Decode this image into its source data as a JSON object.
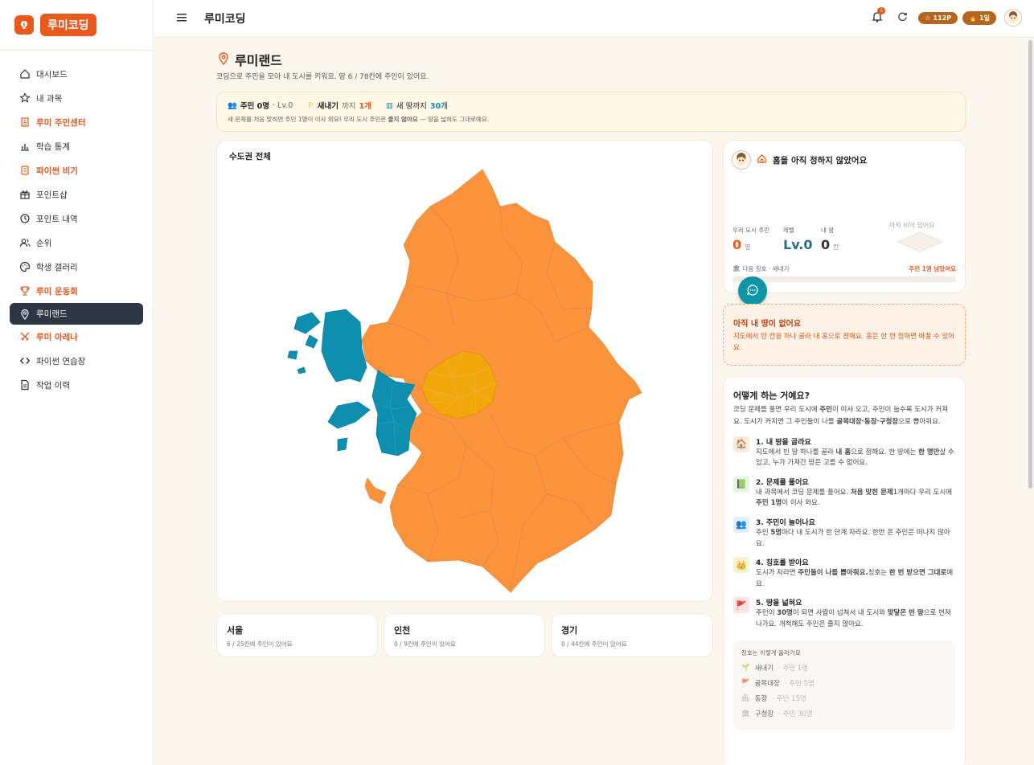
{
  "app": {
    "logo_text": "루미코딩",
    "top_title": "루미코딩",
    "notif_count": "5",
    "points": "112P",
    "streak": "1일"
  },
  "sidebar": {
    "items": [
      {
        "label": "대시보드",
        "icon": "home-icon"
      },
      {
        "label": "내 과목",
        "icon": "star-icon"
      },
      {
        "label": "루미 주민센터",
        "icon": "building-icon"
      },
      {
        "label": "학습 통계",
        "icon": "chart-icon"
      },
      {
        "label": "파이썬 비기",
        "icon": "scroll-icon"
      },
      {
        "label": "포인트샵",
        "icon": "gift-icon"
      },
      {
        "label": "포인트 내역",
        "icon": "history-icon"
      },
      {
        "label": "순위",
        "icon": "users-icon"
      },
      {
        "label": "학생 갤러리",
        "icon": "palette-icon"
      },
      {
        "label": "루미 운동회",
        "icon": "trophy-icon"
      },
      {
        "label": "루미랜드",
        "icon": "map-pin-icon"
      },
      {
        "label": "루미 아레나",
        "icon": "swords-icon"
      },
      {
        "label": "파이썬 연습장",
        "icon": "code-icon"
      },
      {
        "label": "작업 이력",
        "icon": "file-icon"
      }
    ]
  },
  "page": {
    "title": "루미랜드",
    "description": "코딩으로 주민을 모아 내 도시를 키워요. 땅 6 / 78칸에 주인이 있어요.",
    "info": {
      "residents": "주민 0명",
      "level": "· Lv.0",
      "next_title": "새내기",
      "until": "까지",
      "until_count": "1개",
      "new_land": "새 땅까지",
      "new_land_count": "30개",
      "sub_before": "새 문제를 처음 맞히면 주민 1명이 이사 와요! 우리 도시 주민은",
      "sub_bold": "줄지 않아요",
      "sub_after": "— 땅을 넓혀도 그대로예요."
    }
  },
  "map": {
    "title": "수도권 전체"
  },
  "regions": [
    {
      "name": "서울",
      "status": "6 / 25칸에 주인이 있어요"
    },
    {
      "name": "인천",
      "status": "0 / 9칸에 주인이 있어요"
    },
    {
      "name": "경기",
      "status": "0 / 44칸에 주인이 있어요"
    }
  ],
  "home": {
    "title": "홈을 아직 정하지 않았어요",
    "stat1_label": "우리 도시 주민",
    "stat1_value": "0",
    "stat1_unit": "명",
    "stat2_label": "레벨",
    "stat2_value": "Lv.0",
    "stat3_label": "내 땅",
    "stat3_value": "0",
    "stat3_unit": "칸",
    "empty_note": "아직 비어 있어요",
    "next_title_label": "다음 칭호 · 새내기",
    "remaining": "주민 1명 남았어요"
  },
  "empty_notice": {
    "title": "아직 내 땅이 없어요",
    "text": "지도에서 빈 칸을 하나 골라 내 홈으로 정해요. 홈은 한 번 정하면 바꿀 수 있어요."
  },
  "how": {
    "title": "어떻게 하는 거예요?",
    "intro_1": "코딩 문제를 풀면 우리 도시에",
    "intro_b1": "주민",
    "intro_2": "이 이사 오고, 주민이 늘수록 도시가 커져요. 도시가 커지면 그 주민들이 나를",
    "intro_b2": "골목대장·동장·구청장",
    "intro_3": "으로 뽑아줘요.",
    "steps": [
      {
        "title": "1. 내 땅을 골라요",
        "t1": "지도에서 빈 땅 하나를 골라",
        "b1": "내 홈",
        "t2": "으로 정해요. 한 땅에는",
        "b2": "한 명만",
        "t3": "살 수 있고, 누가 가져간 땅은 고를 수 없어요."
      },
      {
        "title": "2. 문제를 풀어요",
        "t1": "내 과목에서 코딩 문제를 풀어요.",
        "b1": "처음 맞힌 문제",
        "t2": "1개마다 우리 도시에",
        "b2": "주민 1명",
        "t3": "이 이사 와요."
      },
      {
        "title": "3. 주민이 늘어나요",
        "t1": "주민",
        "b1": "5명",
        "t2": "마다 내 도시가 한 단계 자라요. 한번 온 주민은 떠나지 않아요.",
        "b2": "",
        "t3": ""
      },
      {
        "title": "4. 칭호를 받아요",
        "t1": "도시가 자라면",
        "b1": "주민들이 나를 뽑아줘요.",
        "t2": "칭호는",
        "b2": "한 번 받으면 그대로",
        "t3": "예요."
      },
      {
        "title": "5. 땅을 넓혀요",
        "t1": "주민이",
        "b1": "30명",
        "t2": "이 되면 사람이 넘쳐서 내 도시와",
        "b2": "맞닿은 빈 땅",
        "t3": "으로 번져나가요. 개척해도 주민은 줄지 않아요."
      }
    ],
    "ladder_title": "칭호는 이렇게 올라가요",
    "ladder": [
      {
        "name": "새내기",
        "req": "· 주민 1명"
      },
      {
        "name": "골목대장",
        "req": "· 주민 5명"
      },
      {
        "name": "동장",
        "req": "· 주민 15명"
      },
      {
        "name": "구청장",
        "req": "· 주민 30명"
      }
    ]
  },
  "colors": {
    "accent": "#ea5a1c",
    "gyeonggi": "#fb923c",
    "incheon": "#0e8fb0",
    "seoul": "#f2a70a",
    "nav_active": "#2e3543"
  }
}
